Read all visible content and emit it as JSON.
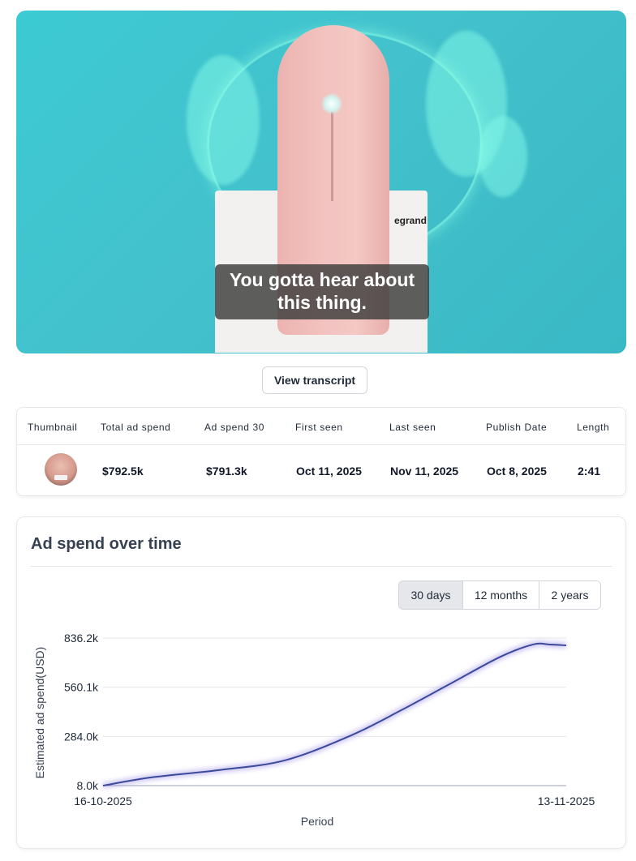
{
  "video": {
    "caption": "You gotta hear about this thing.",
    "brand_text": "egrand"
  },
  "transcript_button": "View transcript",
  "stats": {
    "headers": [
      "Thumbnail",
      "Total ad spend",
      "Ad spend 30",
      "First seen",
      "Last seen",
      "Publish Date",
      "Length"
    ],
    "values": {
      "total_ad_spend": "$792.5k",
      "ad_spend_30": "$791.3k",
      "first_seen": "Oct 11, 2025",
      "last_seen": "Nov 11, 2025",
      "publish_date": "Oct 8, 2025",
      "length": "2:41"
    }
  },
  "chart_section": {
    "title": "Ad spend over time",
    "ranges": [
      "30 days",
      "12 months",
      "2 years"
    ],
    "active_range": "30 days"
  },
  "chart_data": {
    "type": "line",
    "title": "",
    "xlabel": "Period",
    "ylabel": "Estimated ad spend(USD)",
    "x_tick_labels": [
      "16-10-2025",
      "13-11-2025"
    ],
    "y_tick_labels": [
      "8.0k",
      "284.0k",
      "560.1k",
      "836.2k"
    ],
    "ylim": [
      8.0,
      836.2
    ],
    "y_unit": "thousand USD",
    "grid": true,
    "line_color": "#3b4a9a",
    "series": [
      {
        "x": [
          "16-10-2025",
          "19-10-2025",
          "23-10-2025",
          "27-10-2025",
          "31-10-2025",
          "03-11-2025",
          "06-11-2025",
          "09-11-2025",
          "11-11-2025",
          "12-11-2025",
          "13-11-2025"
        ],
        "values": [
          8.0,
          55,
          95,
          150,
          290,
          430,
          580,
          730,
          800,
          800,
          795
        ]
      }
    ]
  }
}
